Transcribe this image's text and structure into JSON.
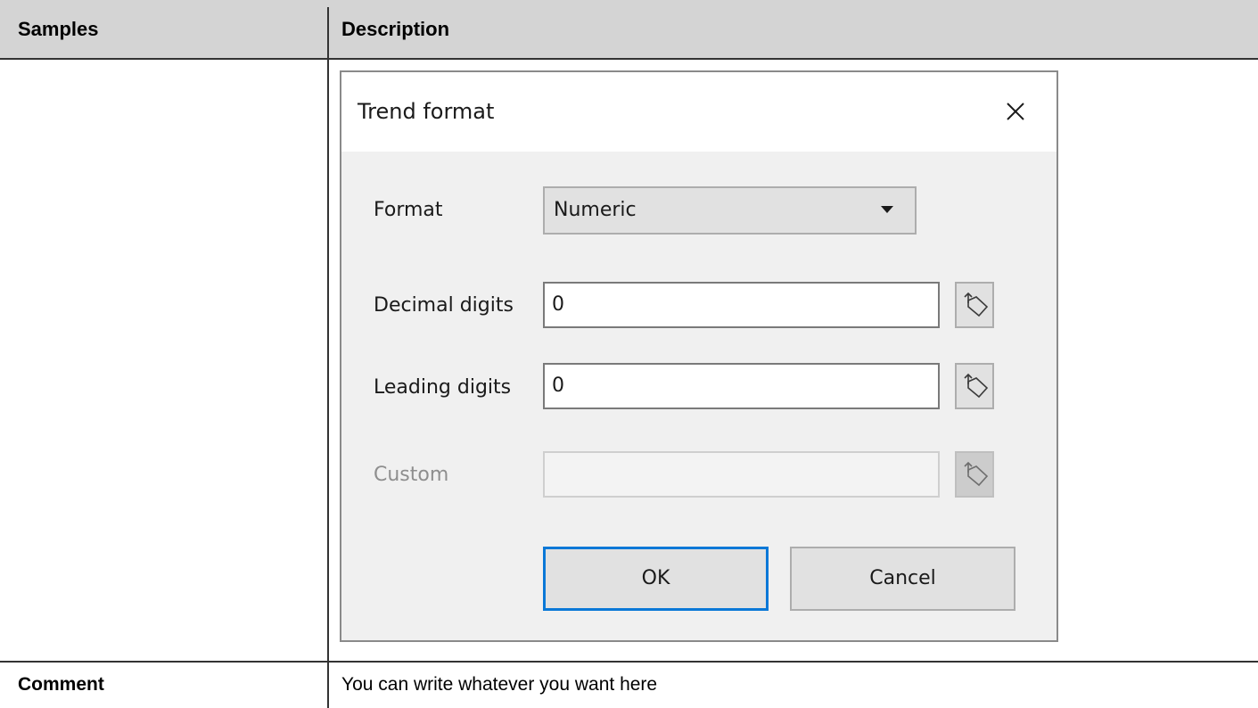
{
  "table": {
    "headers": [
      "Samples",
      "Description"
    ],
    "comment_label": "Comment",
    "comment_text": "You can write whatever you want here"
  },
  "dialog": {
    "title": "Trend format",
    "close_icon": "close-icon",
    "format_label": "Format",
    "format_value": "Numeric",
    "decimal_label": "Decimal digits",
    "decimal_value": "0",
    "leading_label": "Leading digits",
    "leading_value": "0",
    "custom_label": "Custom",
    "custom_value": "",
    "tag_icon": "tag-icon",
    "ok_label": "OK",
    "cancel_label": "Cancel"
  },
  "colors": {
    "header_bg": "#d4d4d4",
    "dialog_bg": "#f0f0f0",
    "focus_border": "#0a78d7"
  }
}
